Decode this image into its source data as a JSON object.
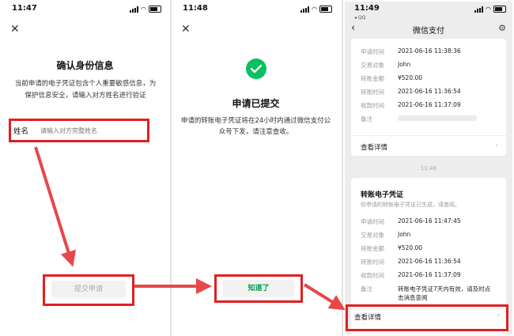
{
  "screen1": {
    "time": "11:47",
    "title": "确认身份信息",
    "description": "当前申请的电子凭证包含个人重要敏感信息，为保护信息安全，请输入对方姓名进行验证",
    "name_label": "姓名",
    "name_placeholder": "请输入对方完整姓名",
    "submit_label": "提交申请"
  },
  "screen2": {
    "time": "11:48",
    "title": "申请已提交",
    "description": "申请的转账电子凭证将在24小时内通过微信支付公众号下发，请注意查收。",
    "ok_label": "知道了"
  },
  "screen3": {
    "time": "11:49",
    "back_app": "◂ QQ",
    "title": "微信支付",
    "card1": {
      "rows": [
        {
          "k": "申请时间",
          "v": "2021-06-16 11:38:36"
        },
        {
          "k": "交易对象",
          "v": "John"
        },
        {
          "k": "转账金额",
          "v": "¥520.00"
        },
        {
          "k": "转账时间",
          "v": "2021-06-16 11:36:54"
        },
        {
          "k": "收款时间",
          "v": "2021-06-16 11:37:09"
        },
        {
          "k": "备注",
          "v": ""
        }
      ],
      "detail_label": "查看详情"
    },
    "timestamp": "11:48",
    "card2": {
      "title": "转账电子凭证",
      "subtitle": "你申请的转账电子凭证已生成，请查阅。",
      "rows": [
        {
          "k": "申请时间",
          "v": "2021-06-16 11:47:45"
        },
        {
          "k": "交易对象",
          "v": "John"
        },
        {
          "k": "转账金额",
          "v": "¥520.00"
        },
        {
          "k": "转账时间",
          "v": "2021-06-16 11:36:54"
        },
        {
          "k": "收款时间",
          "v": "2021-06-16 11:37:09"
        },
        {
          "k": "备注",
          "v": "转账电子凭证7天内有效，请及时点击消息查阅"
        }
      ],
      "detail_label": "查看详情"
    }
  },
  "colors": {
    "accent_green": "#07c160",
    "highlight_red": "#e02020",
    "arrow_red": "#e8474a"
  },
  "icons": [
    "close-icon",
    "check-icon",
    "back-chevron-icon",
    "gear-icon",
    "chevron-right-icon",
    "signal-icon",
    "wifi-icon",
    "battery-icon"
  ]
}
